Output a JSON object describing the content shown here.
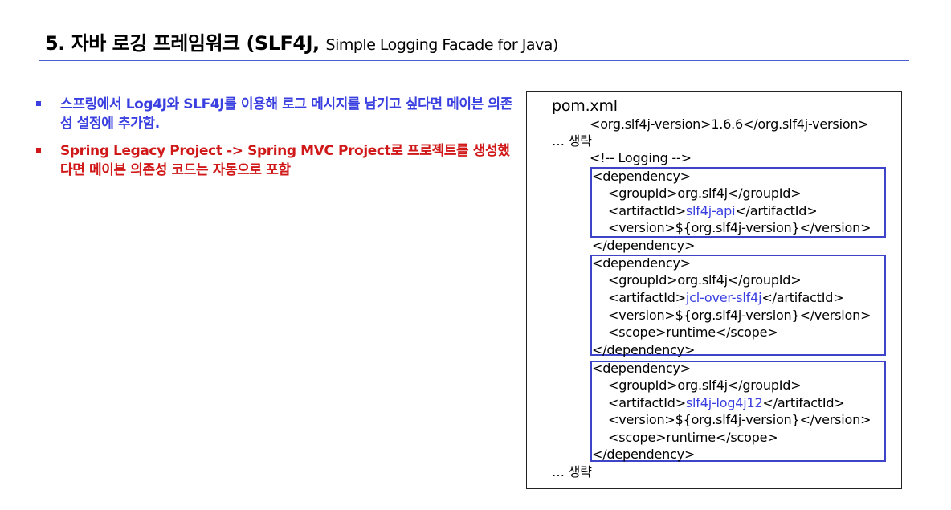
{
  "header": {
    "title_main": "5.  자바 로깅 프레임워크 (SLF4J, ",
    "title_sub": "Simple Logging Facade for Java)"
  },
  "bullets": [
    "스프링에서 Log4J와 SLF4J를 이용해 로그 메시지를 남기고 싶다면 메이븐 의존성 설정에 추가함.",
    "Spring Legacy Project -> Spring MVC Project로 프로젝트를 생성했다면 메이븐 의존성 코드는 자동으로 포함"
  ],
  "colors": {
    "accent_blue": "#3a3fe0",
    "accent_red": "#d01818",
    "rule": "#4a5ed0"
  },
  "code": {
    "file": "pom.xml",
    "version_prop": "<org.slf4j-version>1.6.6</org.slf4j-version>",
    "ellipsis_top": "… 생략",
    "comment": "<!-- Logging -->",
    "dep1": {
      "open": "<dependency>",
      "group": "<groupId>org.slf4j</groupId>",
      "artifact_pre": "<artifactId>",
      "artifact": "slf4j-api",
      "artifact_post": "</artifactId>",
      "version": "<version>${org.slf4j-version}</version>",
      "close": "</dependency>"
    },
    "dep2": {
      "open": "<dependency>",
      "group": "<groupId>org.slf4j</groupId>",
      "artifact_pre": "<artifactId>",
      "artifact": "jcl-over-slf4j",
      "artifact_post": "</artifactId>",
      "version": "<version>${org.slf4j-version}</version>",
      "scope": "<scope>runtime</scope>",
      "close": "</dependency>"
    },
    "dep3": {
      "open": "<dependency>",
      "group": "<groupId>org.slf4j</groupId>",
      "artifact_pre": "<artifactId>",
      "artifact": "slf4j-log4j12",
      "artifact_post": "</artifactId>",
      "version": "<version>${org.slf4j-version}</version>",
      "scope": "<scope>runtime</scope>",
      "close": "</dependency>"
    },
    "ellipsis_bottom": "… 생략"
  }
}
